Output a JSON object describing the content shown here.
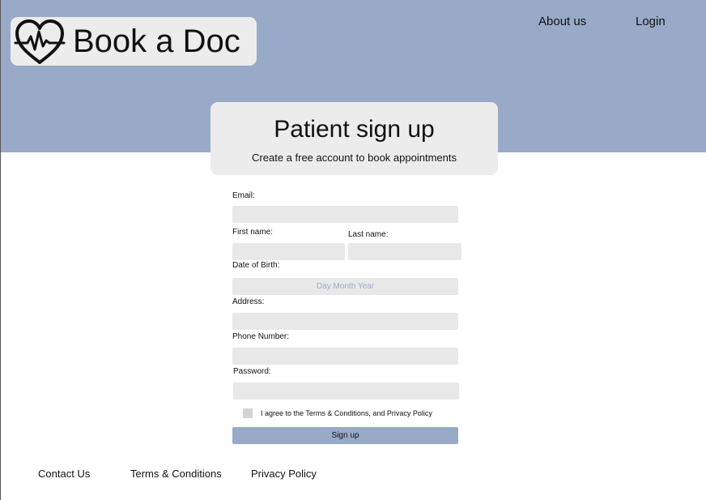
{
  "header": {
    "logo_text": "Book a Doc",
    "logo_icon": "heartbeat-heart-icon",
    "nav": {
      "about_label": "About us",
      "login_label": "Login"
    },
    "band_color": "#98aac8"
  },
  "title_card": {
    "title": "Patient sign up",
    "subtitle": "Create a free account to book appointments"
  },
  "form": {
    "email_label": "Email:",
    "first_name_label": "First name:",
    "last_name_label": "Last name:",
    "dob_label": "Date of Birth:",
    "dob_placeholder": "Day Month Year",
    "address_label": "Address:",
    "phone_label": "Phone Number:",
    "password_label": "Password:",
    "agree_label": "I agree to the Terms & Conditions, and Privacy Policy",
    "submit_label": "Sign up"
  },
  "footer": {
    "contact_label": "Contact Us",
    "terms_label": "Terms & Conditions",
    "privacy_label": "Privacy Policy"
  }
}
